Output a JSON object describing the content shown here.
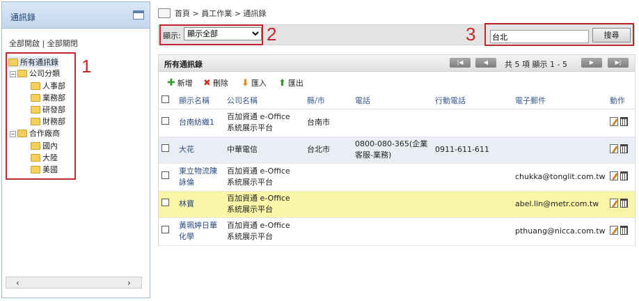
{
  "sidebar": {
    "title": "通訊錄",
    "expand_all": "全部開啟",
    "separator": "|",
    "collapse_all": "全部關閉",
    "tree": {
      "root": "所有通訊錄",
      "group1": "公司分類",
      "group1_items": [
        "人事部",
        "業務部",
        "研發部",
        "財務部"
      ],
      "group2": "合作廠商",
      "group2_items": [
        "國內",
        "大陸",
        "美國"
      ]
    }
  },
  "annotations": [
    "1",
    "2",
    "3"
  ],
  "breadcrumb": "首頁 > 員工作業 > 通訊錄",
  "filter": {
    "label": "顯示:",
    "selected": "顯示全部"
  },
  "search": {
    "value": "台北",
    "button": "搜尋"
  },
  "grid": {
    "title": "所有通訊錄",
    "page_info": "共 5 項 顯示 1 - 5",
    "actions": {
      "add": "新增",
      "delete": "刪除",
      "import": "匯入",
      "export": "匯出"
    },
    "columns": [
      "顯示名稱",
      "公司名稱",
      "縣/市",
      "電話",
      "行動電話",
      "電子郵件",
      "動作"
    ],
    "rows": [
      [
        "台南紡織1",
        "百加資通 e-Office\n系統展示平台",
        "台南市",
        "",
        "",
        "",
        ""
      ],
      [
        "大花",
        "中華電信",
        "台北市",
        "0800-080-365(企業\n客服-業務)",
        "0911-611-611",
        "",
        ""
      ],
      [
        "東立物流陳\n詠倫",
        "百加資通 e-Office\n系統展示平台",
        "",
        "",
        "",
        "chukka@tonglit.com.tw",
        ""
      ],
      [
        "林寶",
        "百加資通 e-Office\n系統展示平台",
        "",
        "",
        "",
        "abel.lin@metr.com.tw",
        ""
      ],
      [
        "黃珮婷日華\n化學",
        "百加資通 e-Office\n系統展示平台",
        "",
        "",
        "",
        "pthuang@nicca.com.tw",
        ""
      ]
    ]
  },
  "colors": {
    "annotation": "#c0272d",
    "highlight_row": "#fbf5a8",
    "alt_row": "#e9eef5"
  }
}
